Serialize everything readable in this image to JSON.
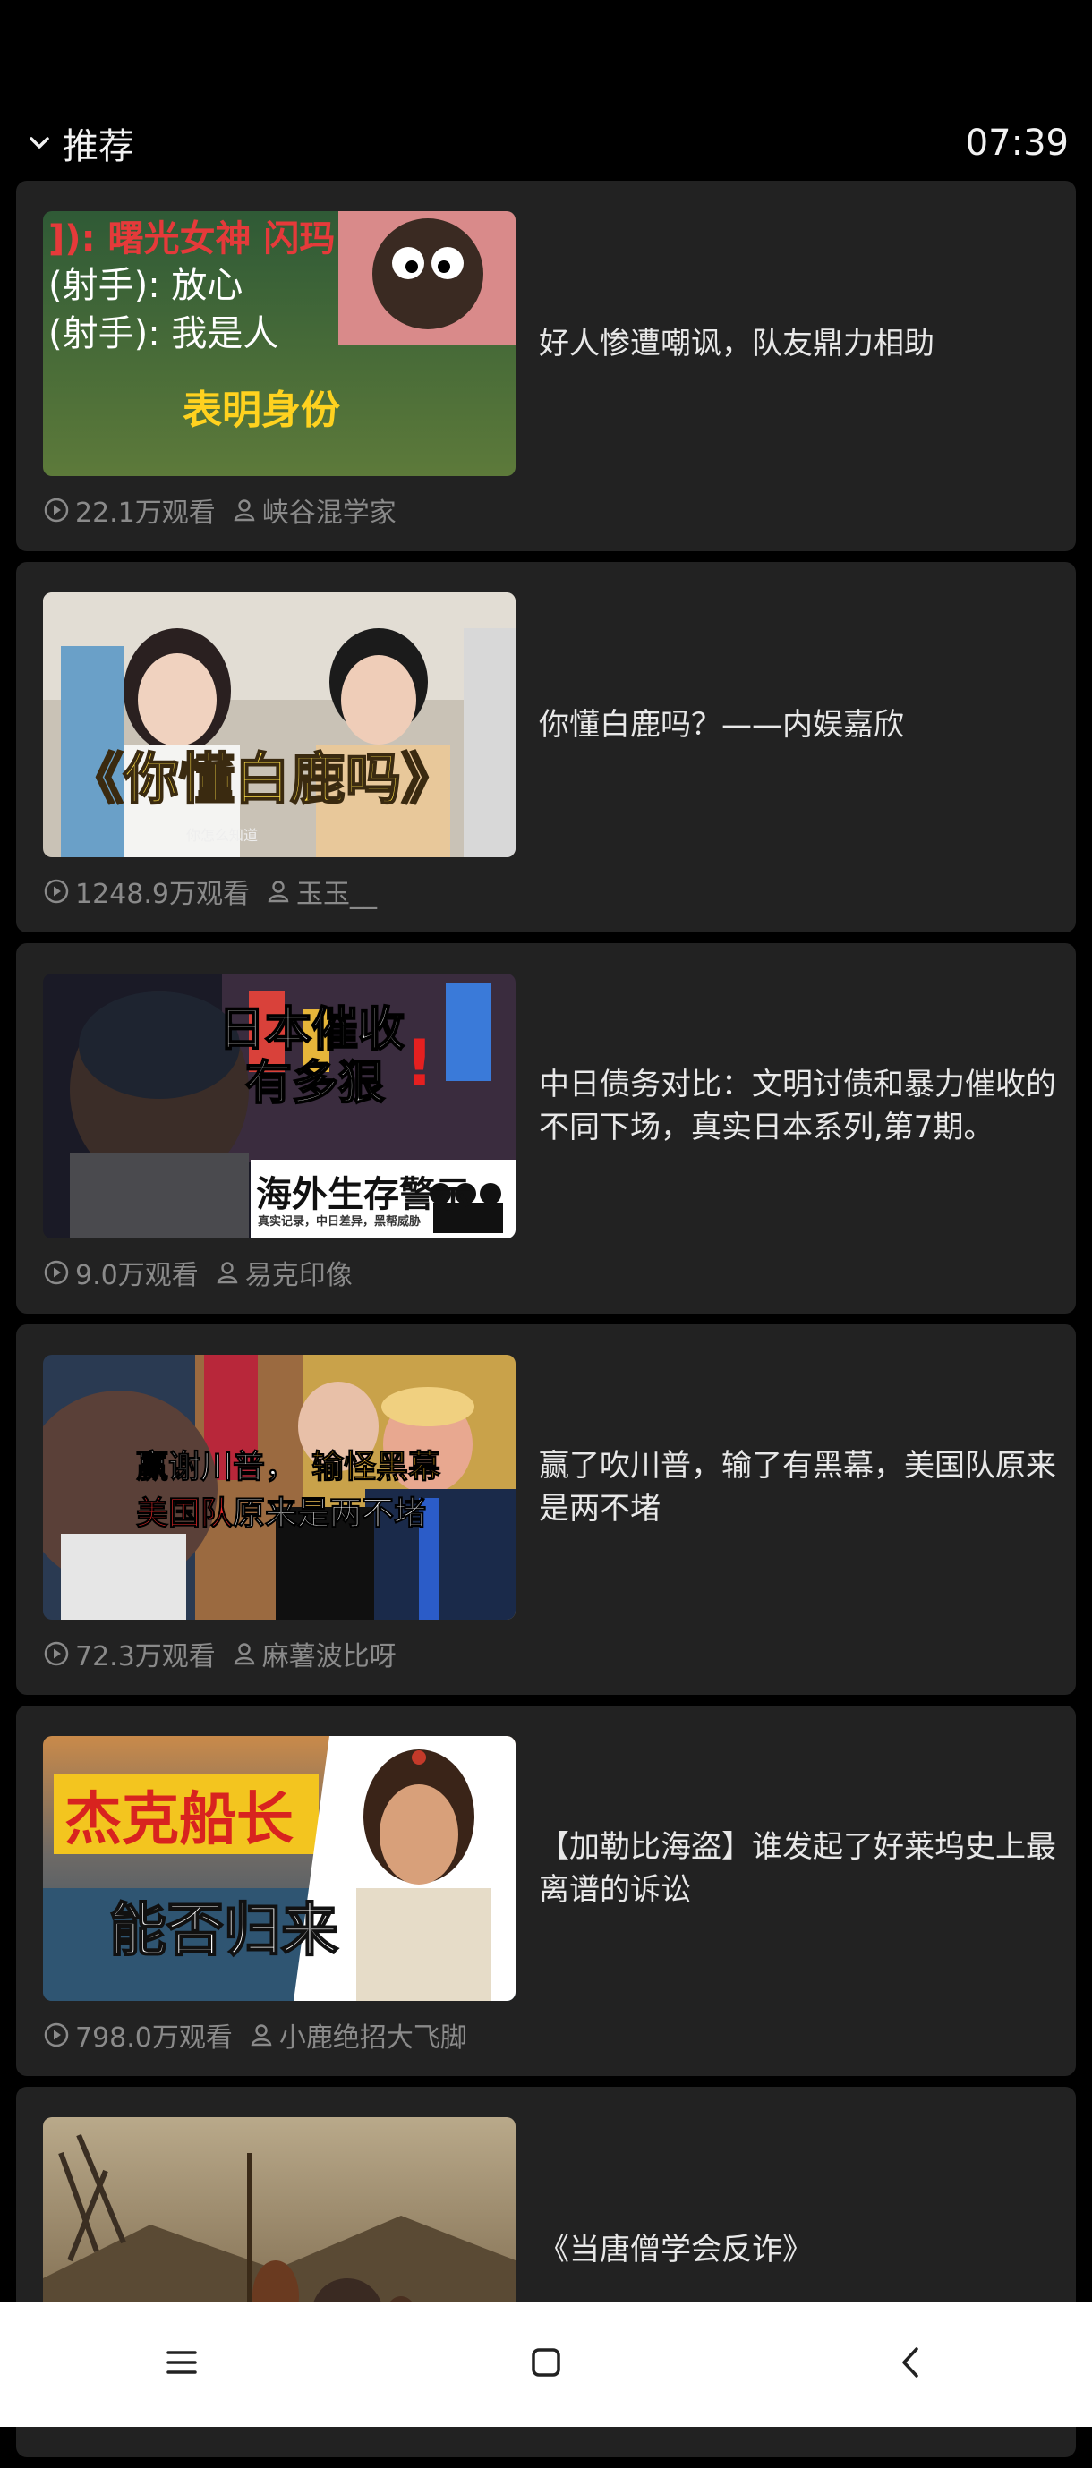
{
  "header": {
    "title": "推荐",
    "time": "07:39"
  },
  "feed": [
    {
      "title": "好人惨遭嘲讽，队友鼎力相助",
      "views": "22.1万观看",
      "author": "峡谷混学家",
      "thumb_text": [
        "]): 曙光女神 闪玛",
        "(射手): 放心",
        "(射手): 我是人",
        "表明身份"
      ]
    },
    {
      "title": "你懂白鹿吗？——内娱嘉欣",
      "views": "1248.9万观看",
      "author": "玉玉__",
      "thumb_text": [
        "《你懂白鹿吗》",
        "你怎么知道"
      ]
    },
    {
      "title": "中日债务对比：文明讨债和暴力催收的不同下场，真实日本系列,第7期。",
      "views": "9.0万观看",
      "author": "易克印像",
      "thumb_text": [
        "日本催收",
        "有多狠",
        "海外生存警示",
        "真实记录，中日差异，黑帮威胁"
      ]
    },
    {
      "title": "赢了吹川普，输了有黑幕，美国队原来是两不堵",
      "views": "72.3万观看",
      "author": "麻薯波比呀",
      "thumb_text": [
        "赢谢川普，",
        "输怪黑幕",
        "美国队",
        "原来是两不堵"
      ]
    },
    {
      "title": "【加勒比海盗】谁发起了好莱坞史上最离谱的诉讼",
      "views": "798.0万观看",
      "author": "小鹿绝招大飞脚",
      "thumb_text": [
        "杰克船长",
        "能否归来"
      ]
    },
    {
      "title": "《当唐僧学会反诈》",
      "views": "",
      "author": "",
      "thumb_text": []
    }
  ],
  "navbar": {
    "icons": [
      "menu-icon",
      "home-icon",
      "back-icon"
    ]
  },
  "colors": {
    "background": "#000000",
    "card": "#222222",
    "meta_text": "#8a8a8a",
    "title_text": "#e8e8e8",
    "navbar": "#ffffff"
  }
}
